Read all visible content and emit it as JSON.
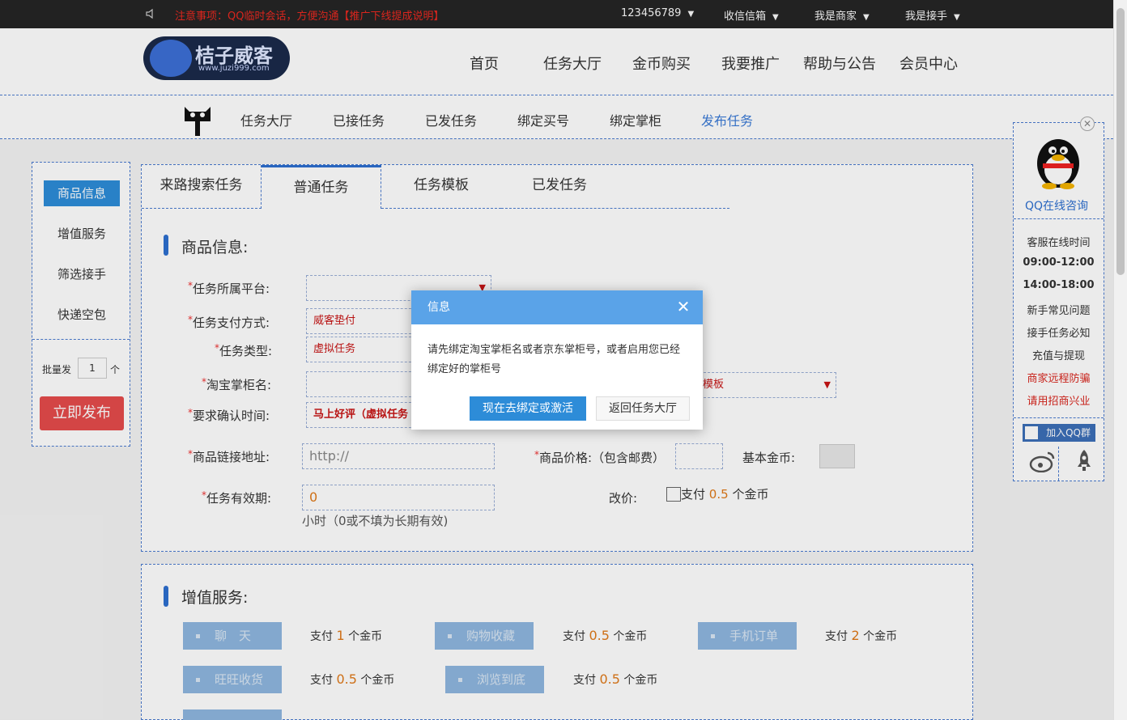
{
  "topbar": {
    "notice": "注意事项：QQ临时会话，方便沟通【推广下线提成说明】",
    "account": "123456789",
    "inbox": "收信信箱",
    "merchant": "我是商家",
    "receiver": "我是接手"
  },
  "header": {
    "logo_brand": "桔子威客",
    "logo_url": "www.juzi999.com",
    "nav": [
      "首页",
      "任务大厅",
      "金币购买",
      "我要推广",
      "帮助与公告",
      "会员中心"
    ]
  },
  "subnav": {
    "items": [
      "任务大厅",
      "已接任务",
      "已发任务",
      "绑定买号",
      "绑定掌柜",
      "发布任务"
    ],
    "active_index": 5
  },
  "sidebar": {
    "items": [
      "商品信息",
      "增值服务",
      "筛选接手",
      "快递空包"
    ],
    "active_index": 0,
    "batch_label": "批量发",
    "batch_value": "1",
    "batch_unit": "个",
    "publish": "立即发布"
  },
  "tabs": [
    "来路搜索任务",
    "普通任务",
    "任务模板",
    "已发任务"
  ],
  "active_tab": 1,
  "form": {
    "section_title": "商品信息:",
    "platform_label": "任务所属平台:",
    "payment_label": "任务支付方式:",
    "payment_value": "威客垫付",
    "type_label": "任务类型:",
    "type_value": "虚拟任务",
    "shop_label": "淘宝掌柜名:",
    "template_value": "模板",
    "confirm_label": "要求确认时间:",
    "confirm_value": "马上好评（虚拟任务",
    "link_label": "商品链接地址:",
    "link_placeholder": "http://",
    "price_label": "商品价格:（包含邮费）",
    "basecoin_label": "基本金币:",
    "validity_label": "任务有效期:",
    "validity_value": "0",
    "validity_hint": "小时（0或不填为长期有效)",
    "reprice_label": "改价:",
    "reprice_text_a": "支付",
    "reprice_num": "0.5",
    "reprice_text_b": "个金币"
  },
  "vas": {
    "section_title": "增值服务:",
    "items": [
      {
        "label": "聊　天",
        "pay": "支付",
        "num": "1",
        "unit": "个金币"
      },
      {
        "label": "购物收藏",
        "pay": "支付",
        "num": "0.5",
        "unit": "个金币"
      },
      {
        "label": "手机订单",
        "pay": "支付",
        "num": "2",
        "unit": "个金币"
      },
      {
        "label": "旺旺收货",
        "pay": "支付",
        "num": "0.5",
        "unit": "个金币"
      },
      {
        "label": "浏览到底",
        "pay": "支付",
        "num": "0.5",
        "unit": "个金币"
      }
    ]
  },
  "qq": {
    "title": "QQ在线咨询",
    "service_time": "客服在线时间",
    "time1": "09:00-12:00",
    "time2": "14:00-18:00",
    "links": [
      "新手常见问题",
      "接手任务必知",
      "充值与提现"
    ],
    "red_links": [
      "商家远程防骗",
      "请用招商兴业"
    ],
    "join": "加入QQ群"
  },
  "dialog": {
    "title": "信息",
    "message": "请先绑定淘宝掌柜名或者京东掌柜号，或者启用您已经绑定好的掌柜号",
    "primary": "现在去绑定或激活",
    "secondary": "返回任务大厅"
  },
  "colors": {
    "accent": "#2d8cd8",
    "dialog_header": "#5aa3e8",
    "danger": "#e54b4b",
    "coin": "#e07a1a"
  }
}
